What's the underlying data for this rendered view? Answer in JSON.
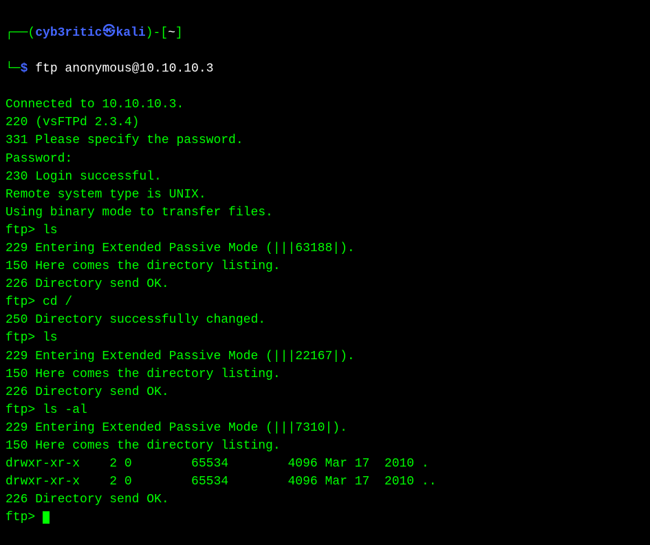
{
  "prompt": {
    "corner_tl": "┌──",
    "lparen": "(",
    "user": "cyb3ritic",
    "skull": "㉿",
    "host": "kali",
    "rparen": ")",
    "dash": "-",
    "lbracket": "[",
    "cwd": "~",
    "rbracket": "]",
    "corner_bl": "└─",
    "dollar": "$",
    "command": " ftp anonymous@10.10.10.3"
  },
  "output": {
    "l01": "Connected to 10.10.10.3.",
    "l02": "220 (vsFTPd 2.3.4)",
    "l03": "331 Please specify the password.",
    "l04": "Password:",
    "l05": "230 Login successful.",
    "l06": "Remote system type is UNIX.",
    "l07": "Using binary mode to transfer files.",
    "l08": "ftp> ls",
    "l09": "229 Entering Extended Passive Mode (|||63188|).",
    "l10": "150 Here comes the directory listing.",
    "l11": "226 Directory send OK.",
    "l12": "ftp> cd /",
    "l13": "250 Directory successfully changed.",
    "l14": "ftp> ls",
    "l15": "229 Entering Extended Passive Mode (|||22167|).",
    "l16": "150 Here comes the directory listing.",
    "l17": "226 Directory send OK.",
    "l18": "ftp> ls -al",
    "l19": "229 Entering Extended Passive Mode (|||7310|).",
    "l20": "150 Here comes the directory listing.",
    "l21": "drwxr-xr-x    2 0        65534        4096 Mar 17  2010 .",
    "l22": "drwxr-xr-x    2 0        65534        4096 Mar 17  2010 ..",
    "l23": "226 Directory send OK.",
    "l24": "ftp> "
  }
}
